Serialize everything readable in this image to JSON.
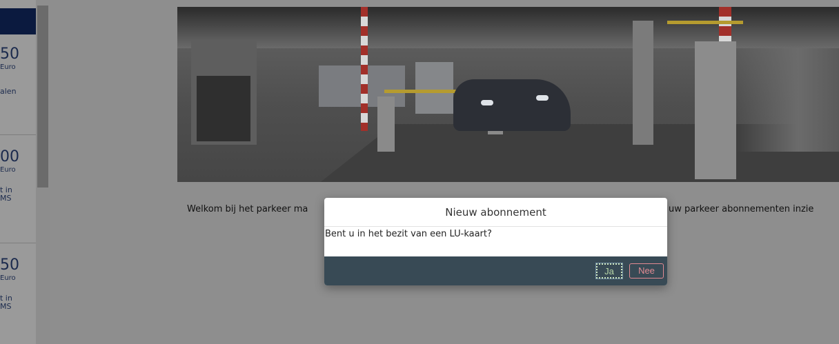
{
  "sidebar": {
    "cards": [
      {
        "price": "50",
        "currency": "Euro",
        "desc": "alen"
      },
      {
        "price": "00",
        "currency": "Euro",
        "desc": "t in\nMS"
      },
      {
        "price": "50",
        "currency": "Euro",
        "desc": "t in\nMS"
      }
    ]
  },
  "main": {
    "welcome_left": "Welkom bij het parkeer ma",
    "welcome_right": "uw parkeer abonnementen inzie"
  },
  "modal": {
    "title": "Nieuw abonnement",
    "question": "Bent u in het bezit van een LU-kaart?",
    "yes_label": "Ja",
    "no_label": "Nee"
  },
  "colors": {
    "sidebar_accent": "#0b1a3f",
    "modal_footer": "#384a55",
    "yes_button": "#b9d7a8",
    "no_button": "#e38b93"
  }
}
